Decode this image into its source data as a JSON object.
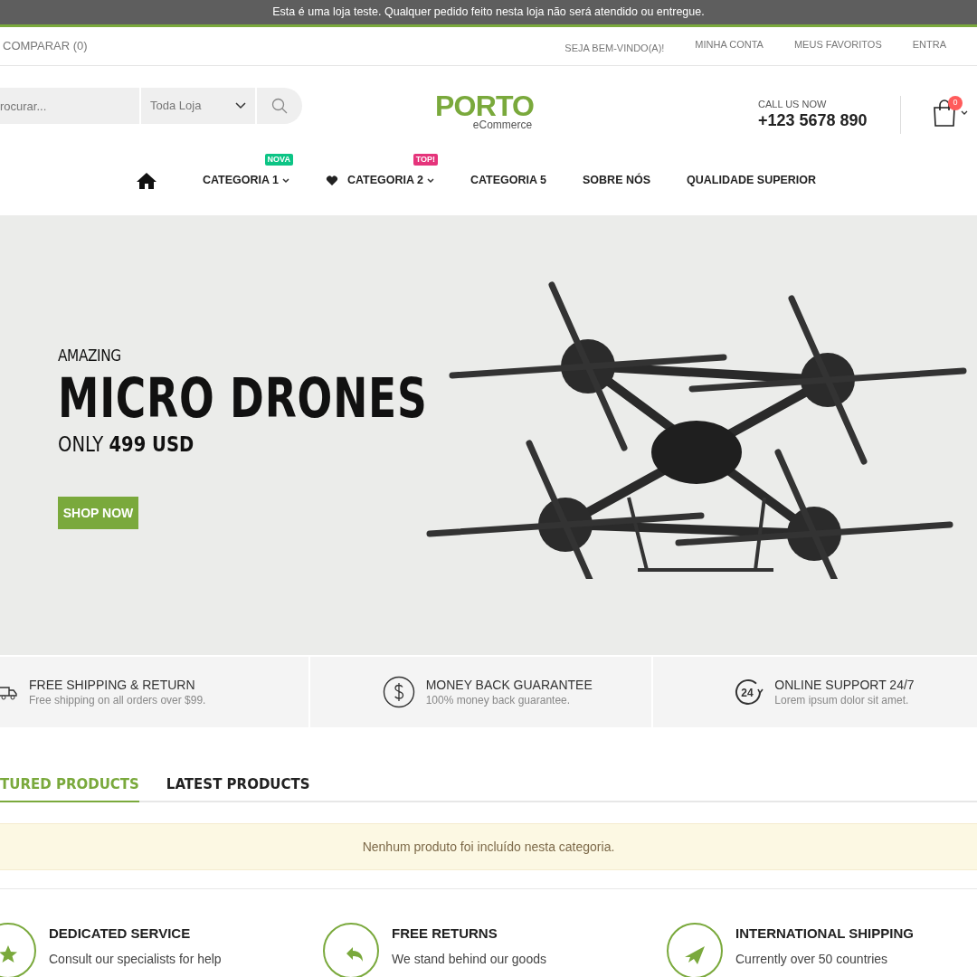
{
  "notice_bar": {
    "text": "Esta é uma loja teste. Qualquer pedido feito nesta loja não será atendido ou entregue."
  },
  "top_links": {
    "compare": "COMPARAR (0)",
    "links": [
      "SEJA BEM-VINDO(A)!",
      "MINHA CONTA",
      "MEUS FAVORITOS",
      "ENTRA"
    ]
  },
  "search": {
    "placeholder": "rocurar...",
    "scope": "Toda Loja"
  },
  "logo": {
    "name": "PORTO",
    "tagline": "eCommerce"
  },
  "contact": {
    "label": "CALL US NOW",
    "phone": "+123 5678 890"
  },
  "cart": {
    "count": "0"
  },
  "nav": [
    {
      "kind": "home"
    },
    {
      "kind": "dropdown",
      "label": "CATEGORIA 1",
      "badge": "NOVA",
      "color": "#0cc485"
    },
    {
      "kind": "favorite-dropdown",
      "label": "CATEGORIA 2",
      "badge": "TOP!",
      "color": "#e5347b"
    },
    {
      "kind": "link",
      "label": "CATEGORIA 5"
    },
    {
      "kind": "link",
      "label": "SOBRE NÓS"
    },
    {
      "kind": "link",
      "label": "QUALIDADE SUPERIOR"
    }
  ],
  "hero": {
    "kicker": "AMAZING",
    "title": "MICRO DRONES",
    "price": "ONLY **499 USD**",
    "button": "SHOP NOW"
  },
  "features": [
    {
      "title": "FREE SHIPPING & RETURN",
      "text": "Free shipping on all orders over $99."
    },
    {
      "title": "MONEY BACK GUARANTEE",
      "text": "100% money back guarantee."
    },
    {
      "icon_text": "24",
      "title": "ONLINE SUPPORT 24/7",
      "text": "Lorem ipsum dolor sit amet."
    }
  ],
  "product_tabs": [
    {
      "label": "TURED PRODUCTS",
      "selected": true
    },
    {
      "label": "LATEST PRODUCTS",
      "selected": false
    }
  ],
  "empty_message": "Nenhum produto foi incluído nesta categoria.",
  "services": [
    {
      "title": "DEDICATED SERVICE",
      "text": "Consult our specialists for help"
    },
    {
      "title": "FREE RETURNS",
      "text": "We stand behind our goods"
    },
    {
      "title": "INTERNATIONAL SHIPPING",
      "text": "Currently over 50 countries"
    }
  ]
}
